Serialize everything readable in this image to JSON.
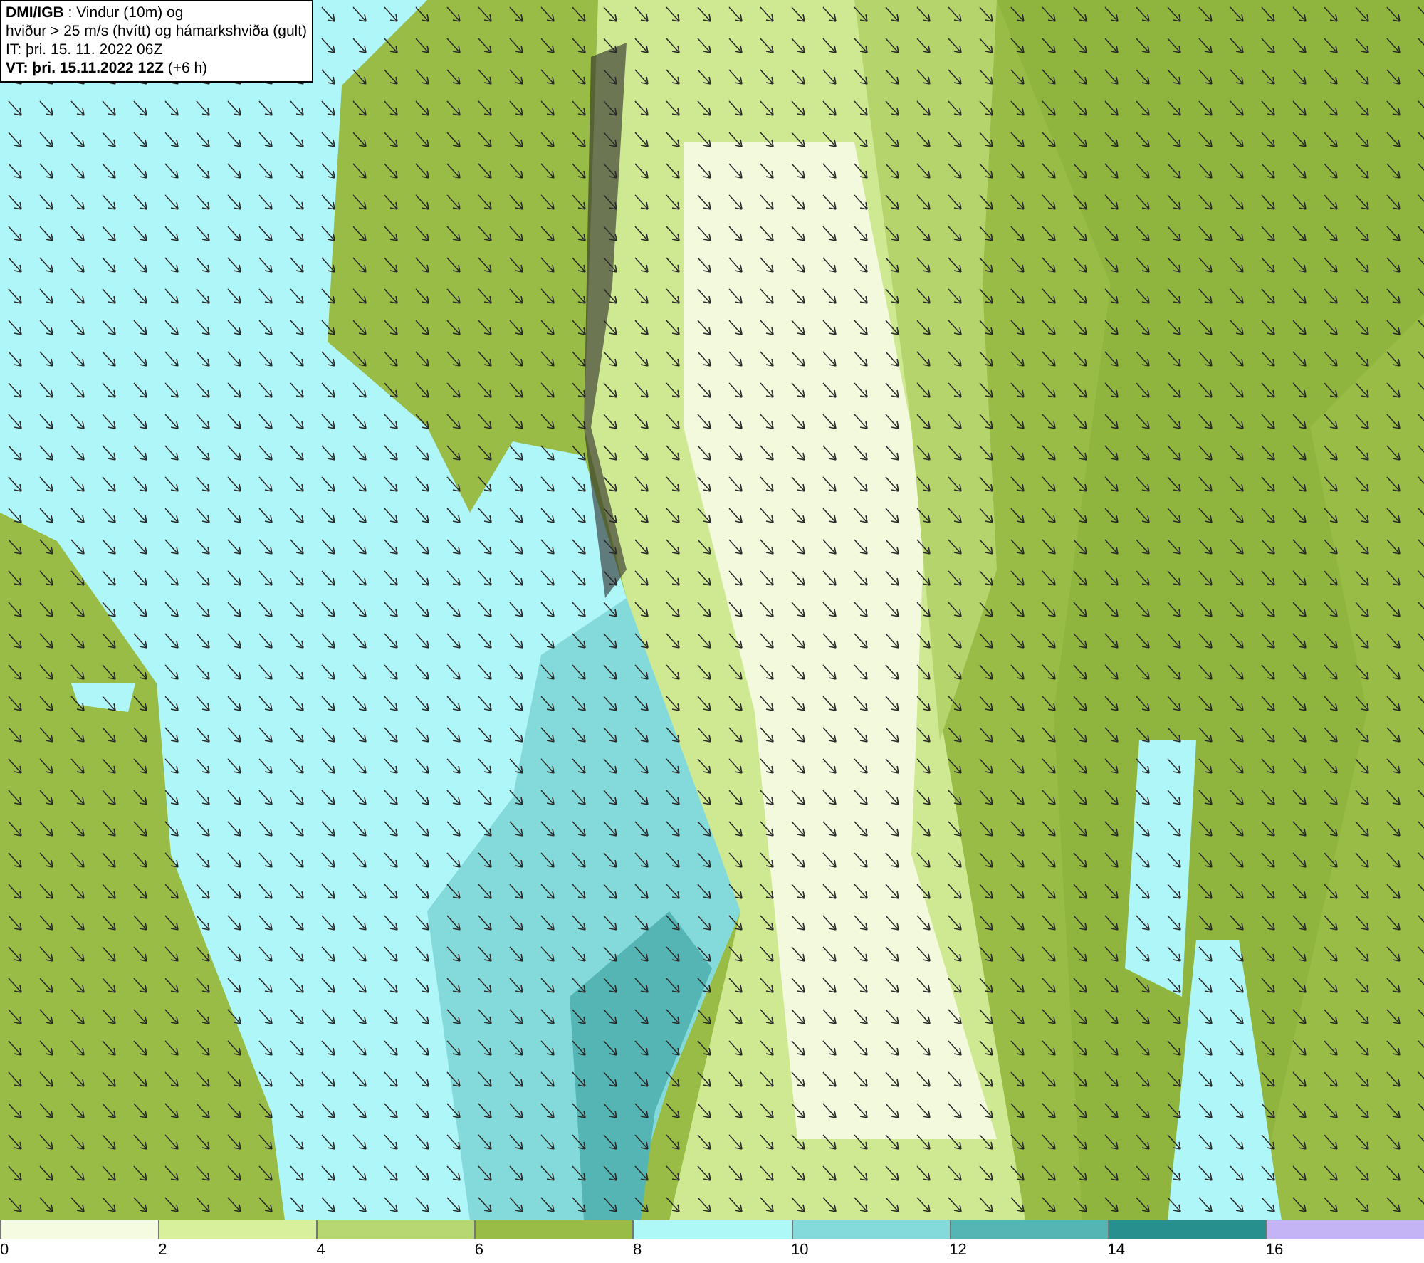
{
  "header": {
    "lines": [
      "**DMI/IGB** : Vindur (10m) og",
      "hviður > 25 m/s (hvítt) og hámarkshviða (gult)",
      "IT: þri. 15. 11. 2022 06Z",
      "**VT: þri. 15.11.2022 12Z** (+6 h)"
    ]
  },
  "legend": {
    "bins": [
      {
        "label": "0",
        "color": "#f5fbe1"
      },
      {
        "label": "2",
        "color": "#d8f09c"
      },
      {
        "label": "4",
        "color": "#b7d773"
      },
      {
        "label": "6",
        "color": "#98bc45"
      },
      {
        "label": "8",
        "color": "#aef8f8"
      },
      {
        "label": "10",
        "color": "#84dada"
      },
      {
        "label": "12",
        "color": "#55b5b5"
      },
      {
        "label": "14",
        "color": "#27908f"
      },
      {
        "label": "16",
        "color": "#c4b3f5"
      }
    ]
  }
}
